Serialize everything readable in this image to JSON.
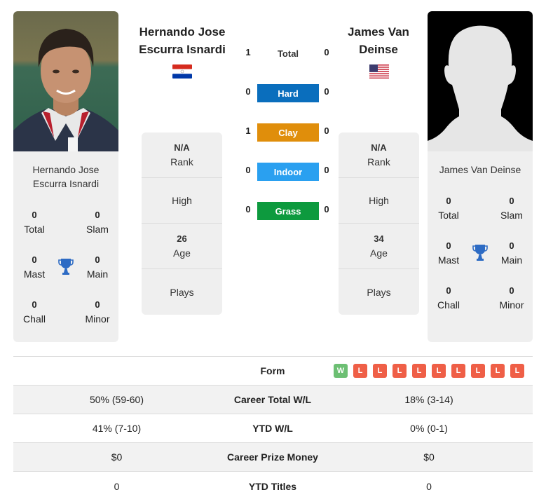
{
  "player1": {
    "name": "Hernando Jose Escurra Isnardi",
    "header_line1": "Hernando Jose",
    "header_line2": "Escurra Isnardi",
    "card_line1": "Hernando Jose",
    "card_line2": "Escurra Isnardi",
    "flag": "paraguay-flag",
    "titles": {
      "total": {
        "value": "0",
        "label": "Total"
      },
      "slam": {
        "value": "0",
        "label": "Slam"
      },
      "mast": {
        "value": "0",
        "label": "Mast"
      },
      "main": {
        "value": "0",
        "label": "Main"
      },
      "chall": {
        "value": "0",
        "label": "Chall"
      },
      "minor": {
        "value": "0",
        "label": "Minor"
      }
    },
    "info": {
      "rank": {
        "value": "N/A",
        "label": "Rank"
      },
      "high": {
        "label": "High"
      },
      "age": {
        "value": "26",
        "label": "Age"
      },
      "plays": {
        "label": "Plays"
      }
    }
  },
  "player2": {
    "name": "James Van Deinse",
    "header_line1": "James Van",
    "header_line2": "Deinse",
    "card_line1": "James Van Deinse",
    "flag": "usa-flag",
    "titles": {
      "total": {
        "value": "0",
        "label": "Total"
      },
      "slam": {
        "value": "0",
        "label": "Slam"
      },
      "mast": {
        "value": "0",
        "label": "Mast"
      },
      "main": {
        "value": "0",
        "label": "Main"
      },
      "chall": {
        "value": "0",
        "label": "Chall"
      },
      "minor": {
        "value": "0",
        "label": "Minor"
      }
    },
    "info": {
      "rank": {
        "value": "N/A",
        "label": "Rank"
      },
      "high": {
        "label": "High"
      },
      "age": {
        "value": "34",
        "label": "Age"
      },
      "plays": {
        "label": "Plays"
      }
    }
  },
  "h2h": {
    "total": {
      "label": "Total",
      "p1": "1",
      "p2": "0"
    },
    "surfaces": [
      {
        "label": "Hard",
        "p1": "0",
        "p2": "0",
        "color": "#0a6ebd"
      },
      {
        "label": "Clay",
        "p1": "1",
        "p2": "0",
        "color": "#e08e0b"
      },
      {
        "label": "Indoor",
        "p1": "0",
        "p2": "0",
        "color": "#2aa0f0"
      },
      {
        "label": "Grass",
        "p1": "0",
        "p2": "0",
        "color": "#0d9a3e"
      }
    ]
  },
  "comparison": {
    "form_label": "Form",
    "form": [
      "W",
      "L",
      "L",
      "L",
      "L",
      "L",
      "L",
      "L",
      "L",
      "L"
    ],
    "colors": {
      "win": "#6cbf73",
      "loss": "#ef5f47"
    },
    "rows": [
      {
        "label": "Career Total W/L",
        "p1": "50% (59-60)",
        "p2": "18% (3-14)"
      },
      {
        "label": "YTD W/L",
        "p1": "41% (7-10)",
        "p2": "0% (0-1)"
      },
      {
        "label": "Career Prize Money",
        "p1": "$0",
        "p2": "$0"
      },
      {
        "label": "YTD Titles",
        "p1": "0",
        "p2": "0"
      }
    ]
  }
}
